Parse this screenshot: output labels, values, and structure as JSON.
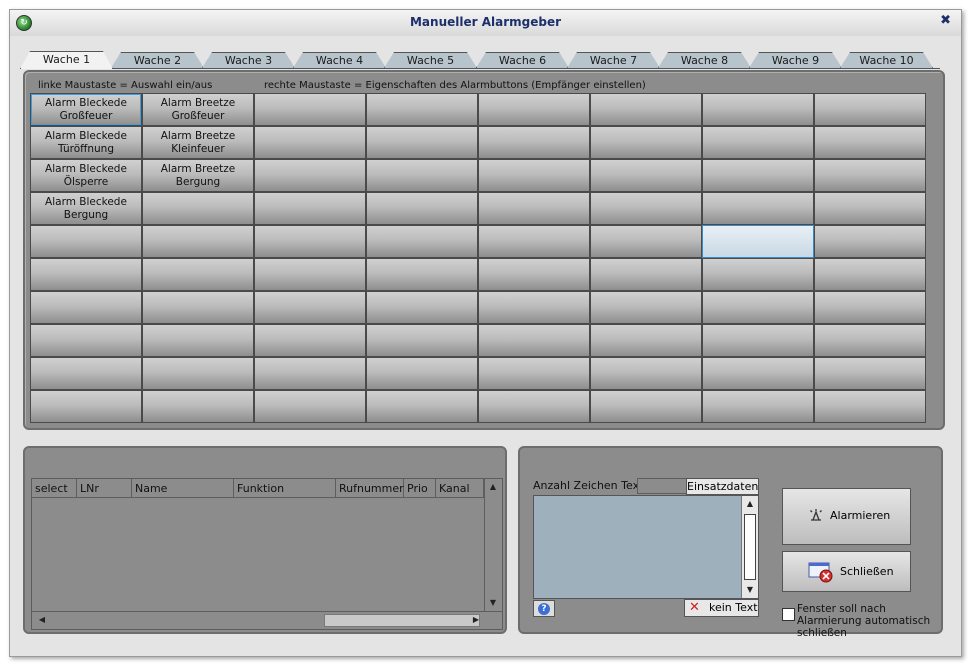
{
  "window": {
    "title": "Manueller Alarmgeber",
    "close_symbol": "✖"
  },
  "tabs": [
    {
      "label": "Wache 1",
      "active": true
    },
    {
      "label": "Wache 2"
    },
    {
      "label": "Wache 3"
    },
    {
      "label": "Wache 4"
    },
    {
      "label": "Wache 5"
    },
    {
      "label": "Wache 6"
    },
    {
      "label": "Wache 7"
    },
    {
      "label": "Wache 8"
    },
    {
      "label": "Wache 9"
    },
    {
      "label": "Wache 10"
    }
  ],
  "hints": {
    "left": "linke Maustaste = Auswahl ein/aus",
    "right": "rechte Maustaste = Eigenschaften des Alarmbuttons (Empfänger einstellen)"
  },
  "alarm_grid": {
    "columns": 8,
    "rows": 10,
    "buttons": [
      [
        "Alarm Bleckede\nGroßfeuer",
        "Alarm Breetze\nGroßfeuer",
        "",
        "",
        "",
        "",
        "",
        ""
      ],
      [
        "Alarm Bleckede\nTüröffnung",
        "Alarm Breetze\nKleinfeuer",
        "",
        "",
        "",
        "",
        "",
        ""
      ],
      [
        "Alarm Bleckede\nÖlsperre",
        "Alarm Breetze\nBergung",
        "",
        "",
        "",
        "",
        "",
        ""
      ],
      [
        "Alarm Bleckede\nBergung",
        "",
        "",
        "",
        "",
        "",
        "",
        ""
      ],
      [
        "",
        "",
        "",
        "",
        "",
        "",
        "",
        ""
      ],
      [
        "",
        "",
        "",
        "",
        "",
        "",
        "",
        ""
      ],
      [
        "",
        "",
        "",
        "",
        "",
        "",
        "",
        ""
      ],
      [
        "",
        "",
        "",
        "",
        "",
        "",
        "",
        ""
      ],
      [
        "",
        "",
        "",
        "",
        "",
        "",
        "",
        ""
      ],
      [
        "",
        "",
        "",
        "",
        "",
        "",
        "",
        ""
      ]
    ]
  },
  "recipients_table": {
    "columns": [
      "select",
      "LNr",
      "Name",
      "Funktion",
      "Rufnummer",
      "Prio",
      "Kanal"
    ],
    "rows": []
  },
  "message": {
    "count_label": "Anzahl Zeichen Text",
    "count_value": "",
    "einsatzdaten_label": "Einsatzdaten",
    "text": "",
    "kein_text_label": "kein Text"
  },
  "actions": {
    "alarm_label": "Alarmieren",
    "close_label": "Schließen",
    "auto_close_label": "Fenster soll nach Alarmierung automatisch schließen",
    "auto_close_checked": false
  }
}
